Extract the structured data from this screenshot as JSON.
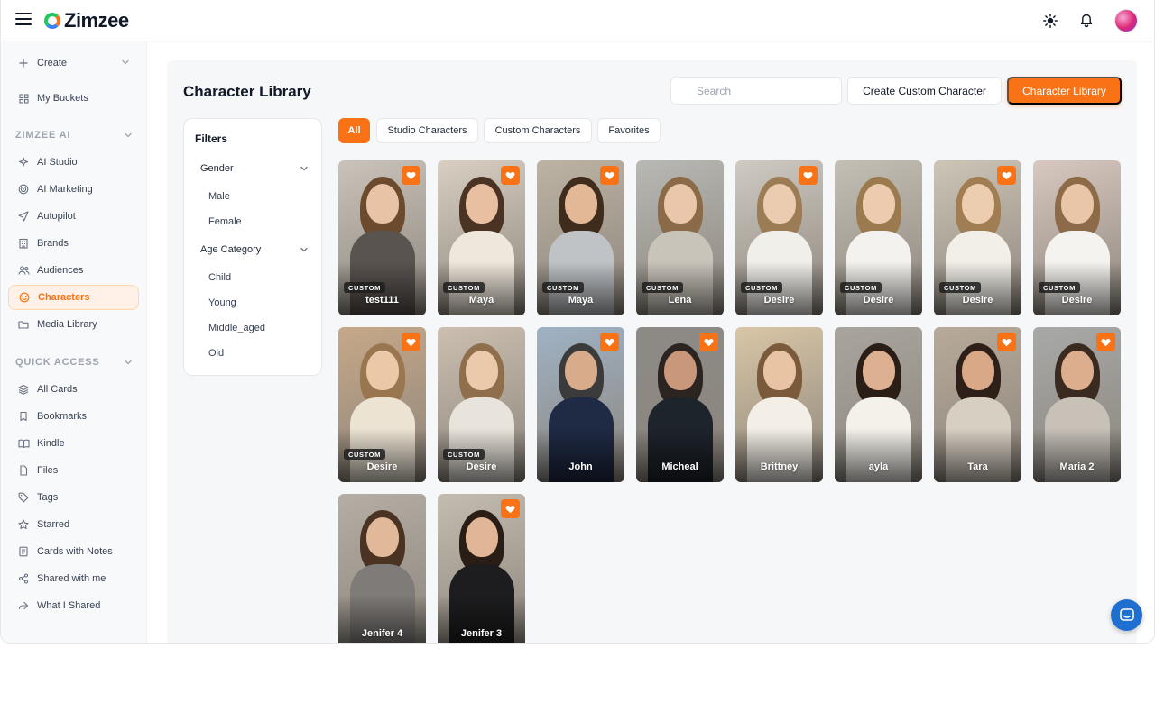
{
  "app": {
    "name": "Zimzee"
  },
  "colors": {
    "accent": "#f97316",
    "chat": "#1f6fd1"
  },
  "sidebar": {
    "create_label": "Create",
    "my_buckets_label": "My Buckets",
    "section_ai": "ZIMZEE AI",
    "ai_items": [
      {
        "label": "AI Studio",
        "icon": "sparkle-icon"
      },
      {
        "label": "AI Marketing",
        "icon": "target-icon"
      },
      {
        "label": "Autopilot",
        "icon": "paper-plane-icon"
      },
      {
        "label": "Brands",
        "icon": "building-icon"
      },
      {
        "label": "Audiences",
        "icon": "users-icon"
      },
      {
        "label": "Characters",
        "icon": "smile-icon"
      },
      {
        "label": "Media Library",
        "icon": "folder-icon"
      }
    ],
    "section_quick": "QUICK ACCESS",
    "quick_items": [
      {
        "label": "All Cards",
        "icon": "stack-icon"
      },
      {
        "label": "Bookmarks",
        "icon": "bookmark-icon"
      },
      {
        "label": "Kindle",
        "icon": "book-icon"
      },
      {
        "label": "Files",
        "icon": "file-icon"
      },
      {
        "label": "Tags",
        "icon": "tag-icon"
      },
      {
        "label": "Starred",
        "icon": "star-icon"
      },
      {
        "label": "Cards with Notes",
        "icon": "note-icon"
      },
      {
        "label": "Shared with me",
        "icon": "share-icon"
      },
      {
        "label": "What I Shared",
        "icon": "forward-icon"
      }
    ]
  },
  "main": {
    "title": "Character Library",
    "search_placeholder": "Search",
    "create_custom_label": "Create Custom Character",
    "library_label": "Character Library"
  },
  "filters": {
    "title": "Filters",
    "gender_label": "Gender",
    "gender_options": [
      "Male",
      "Female"
    ],
    "age_label": "Age Category",
    "age_options": [
      "Child",
      "Young",
      "Middle_aged",
      "Old"
    ]
  },
  "tabs": [
    "All",
    "Studio Characters",
    "Custom Characters",
    "Favorites"
  ],
  "badge_label": "CUSTOM",
  "characters": [
    {
      "name": "test111",
      "custom": true,
      "favorite": true,
      "bg": "#c9c3bb",
      "hair": "#6b4a2e",
      "skin": "#e9c3a5",
      "top": "#5a5450"
    },
    {
      "name": "Maya",
      "custom": true,
      "favorite": true,
      "bg": "#d9cfc3",
      "hair": "#4a3322",
      "skin": "#e8c0a1",
      "top": "#efe7db"
    },
    {
      "name": "Maya",
      "custom": true,
      "favorite": true,
      "bg": "#bdb3a4",
      "hair": "#3f2c1d",
      "skin": "#e3b897",
      "top": "#bfc3c6"
    },
    {
      "name": "Lena",
      "custom": true,
      "favorite": false,
      "bg": "#b8b8b4",
      "hair": "#8a6a47",
      "skin": "#eac7aa",
      "top": "#c9c4ba"
    },
    {
      "name": "Desire",
      "custom": true,
      "favorite": true,
      "bg": "#cfcac2",
      "hair": "#9c7c55",
      "skin": "#ecccb0",
      "top": "#f1efea"
    },
    {
      "name": "Desire",
      "custom": true,
      "favorite": false,
      "bg": "#c4bfb4",
      "hair": "#9b7a50",
      "skin": "#eccbae",
      "top": "#f4f2ee"
    },
    {
      "name": "Desire",
      "custom": true,
      "favorite": true,
      "bg": "#cdc5b6",
      "hair": "#a07d52",
      "skin": "#edcdb0",
      "top": "#f2efe8"
    },
    {
      "name": "Desire",
      "custom": true,
      "favorite": false,
      "bg": "#d8c8c0",
      "hair": "#8d6b48",
      "skin": "#eac6a9",
      "top": "#f5f3ef"
    },
    {
      "name": "Desire",
      "custom": true,
      "favorite": true,
      "bg": "#c6a888",
      "hair": "#9a7650",
      "skin": "#ebc8a8",
      "top": "#ece3d3"
    },
    {
      "name": "Desire",
      "custom": true,
      "favorite": false,
      "bg": "#cbbfb0",
      "hair": "#8f6e4c",
      "skin": "#ebc9ab",
      "top": "#e9e4db"
    },
    {
      "name": "John",
      "custom": false,
      "favorite": true,
      "bg": "#9fb2c4",
      "hair": "#3b3b3b",
      "skin": "#d8ab8b",
      "top": "#1f2a44"
    },
    {
      "name": "Micheal",
      "custom": false,
      "favorite": true,
      "bg": "#8d8a86",
      "hair": "#2b2420",
      "skin": "#c9977a",
      "top": "#1e242c"
    },
    {
      "name": "Brittney",
      "custom": false,
      "favorite": false,
      "bg": "#d9c6a6",
      "hair": "#7a5a3a",
      "skin": "#e8c4a4",
      "top": "#f3efe6"
    },
    {
      "name": "ayla",
      "custom": false,
      "favorite": false,
      "bg": "#a9a59e",
      "hair": "#2a1e17",
      "skin": "#dcb091",
      "top": "#f4f1ea"
    },
    {
      "name": "Tara",
      "custom": false,
      "favorite": true,
      "bg": "#b7aa9a",
      "hair": "#2e2018",
      "skin": "#d9a987",
      "top": "#d8cfc3"
    },
    {
      "name": "Maria 2",
      "custom": false,
      "favorite": true,
      "bg": "#a8a9a8",
      "hair": "#3a2a1f",
      "skin": "#dcae8e",
      "top": "#c7c1b8"
    },
    {
      "name": "Jenifer 4",
      "custom": false,
      "favorite": false,
      "bg": "#b5aea4",
      "hair": "#4a3322",
      "skin": "#e1b898",
      "top": "#7f7b78"
    },
    {
      "name": "Jenifer 3",
      "custom": false,
      "favorite": true,
      "bg": "#c4bcb0",
      "hair": "#2a1d15",
      "skin": "#e1b696",
      "top": "#1d1d1f"
    }
  ]
}
